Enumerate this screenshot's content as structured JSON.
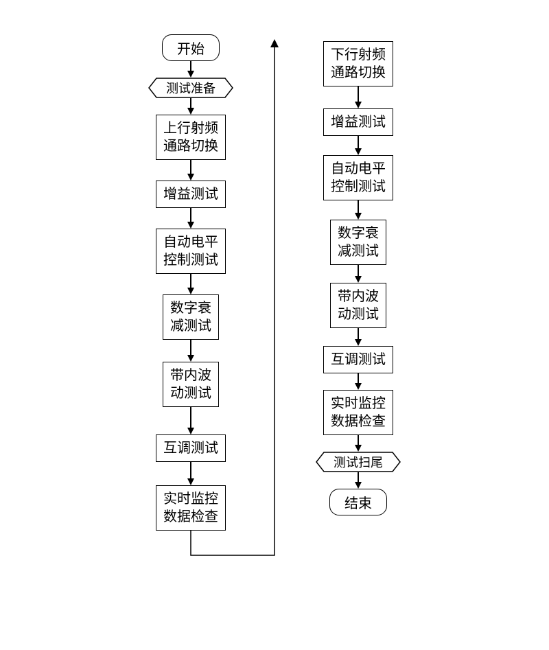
{
  "left": {
    "start": "开始",
    "prep": "测试准备",
    "s1": "上行射频\n通路切换",
    "s2": "增益测试",
    "s3": "自动电平\n控制测试",
    "s4": "数字衰\n减测试",
    "s5": "带内波\n动测试",
    "s6": "互调测试",
    "s7": "实时监控\n数据检查"
  },
  "right": {
    "s1": "下行射频\n通路切换",
    "s2": "增益测试",
    "s3": "自动电平\n控制测试",
    "s4": "数字衰\n减测试",
    "s5": "带内波\n动测试",
    "s6": "互调测试",
    "s7": "实时监控\n数据检查",
    "cleanup": "测试扫尾",
    "end": "结束"
  }
}
